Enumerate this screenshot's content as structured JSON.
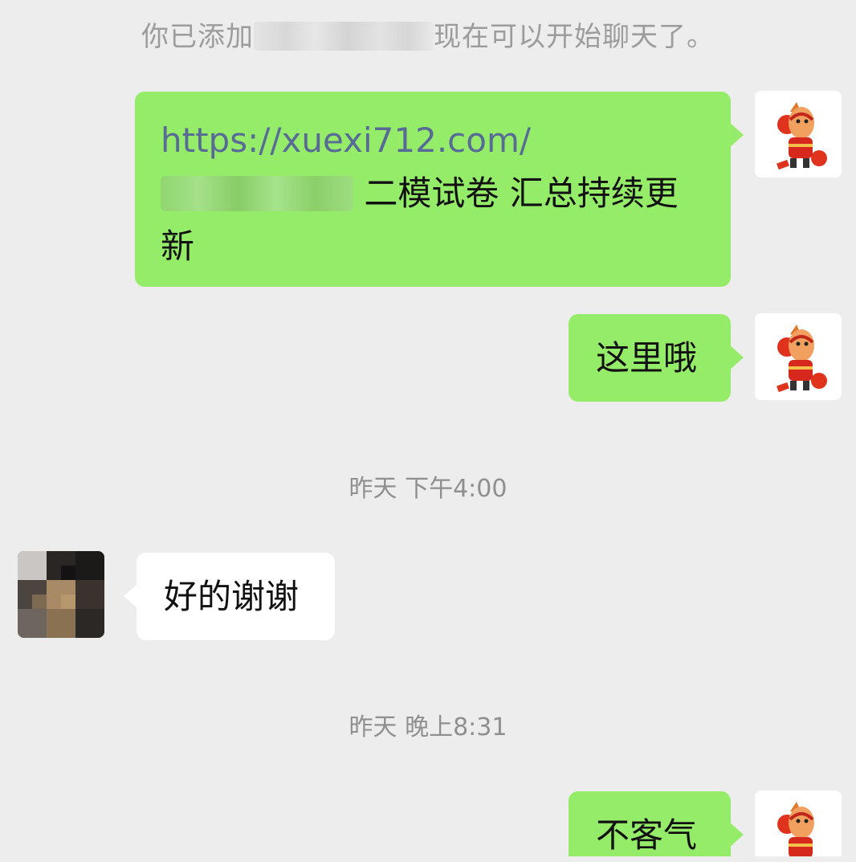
{
  "system_note": {
    "prefix": "你已添加",
    "suffix": "现在可以开始聊天了。"
  },
  "messages": {
    "m1": {
      "link": "https://xuexi712.com/",
      "text": "二模试卷 汇总持续更新"
    },
    "m2": {
      "text": "这里哦"
    },
    "t1": {
      "text": "昨天 下午4:00"
    },
    "m3": {
      "text": "好的谢谢"
    },
    "t2": {
      "text": "昨天 晚上8:31"
    },
    "m4": {
      "text": "不客气"
    }
  },
  "colors": {
    "background": "#ededed",
    "outgoing_bubble": "#95ec69",
    "incoming_bubble": "#ffffff",
    "link": "#576b95",
    "system_text": "#9c9c9c"
  },
  "icons": {
    "self_avatar": "cartoon-horse-mascot-icon",
    "other_avatar": "pixelated-user-avatar"
  }
}
